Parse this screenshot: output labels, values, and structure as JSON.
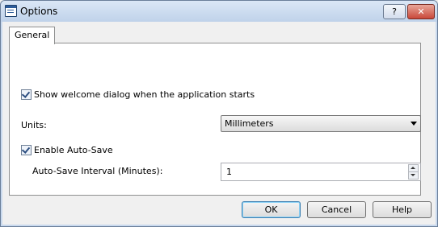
{
  "window": {
    "title": "Options",
    "help_caption": "?",
    "close_caption": "✕"
  },
  "tabs": [
    {
      "label": "General",
      "selected": true
    }
  ],
  "general": {
    "show_welcome": {
      "label": "Show welcome dialog when the application starts",
      "checked": true
    },
    "units": {
      "label": "Units:",
      "value": "Millimeters"
    },
    "auto_save": {
      "label": "Enable Auto-Save",
      "checked": true
    },
    "auto_save_interval": {
      "label": "Auto-Save Interval (Minutes):",
      "value": "1"
    }
  },
  "buttons": {
    "ok": "OK",
    "cancel": "Cancel",
    "help": "Help"
  },
  "icons": {
    "app": "options-app-icon",
    "check": "check-icon",
    "dropdown": "chevron-down-icon",
    "spin_up": "spin-up-icon",
    "spin_down": "spin-down-icon"
  },
  "colors": {
    "close_button": "#c9483a",
    "titlebar": "#c9d9ee",
    "default_button_border": "#3c7fb1"
  }
}
